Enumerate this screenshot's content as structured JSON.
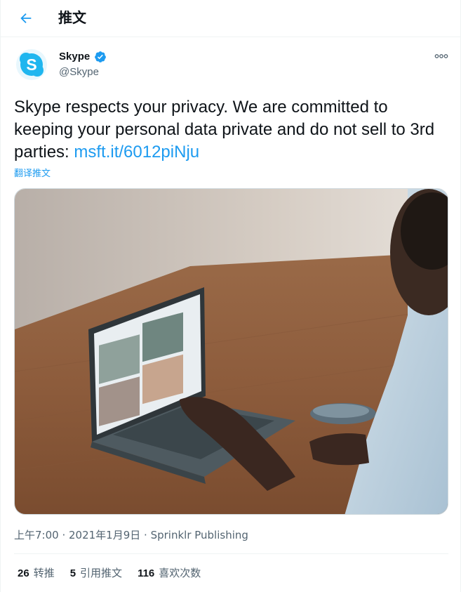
{
  "header": {
    "title": "推文",
    "back_icon": "arrow-left-icon"
  },
  "author": {
    "name": "Skype",
    "handle": "@Skype",
    "verified": true,
    "avatar_icon": "skype-logo-icon",
    "avatar_letter": "S",
    "brand_color": "#1fb6ef"
  },
  "tweet": {
    "text_before_link": "Skype respects your privacy. We are committed to keeping your personal data private and do not sell to 3rd parties: ",
    "link_text": "msft.it/6012piNju",
    "translate_label": "翻译推文"
  },
  "meta": {
    "time": "上午7:00",
    "date": "2021年1月9日",
    "separator": " · ",
    "source": "Sprinklr Publishing"
  },
  "stats": [
    {
      "count": "26",
      "label": "转推"
    },
    {
      "count": "5",
      "label": "引用推文"
    },
    {
      "count": "116",
      "label": "喜欢次数"
    }
  ],
  "colors": {
    "accent": "#1d9bf0",
    "secondary_text": "#536471",
    "border": "#eff3f4"
  }
}
